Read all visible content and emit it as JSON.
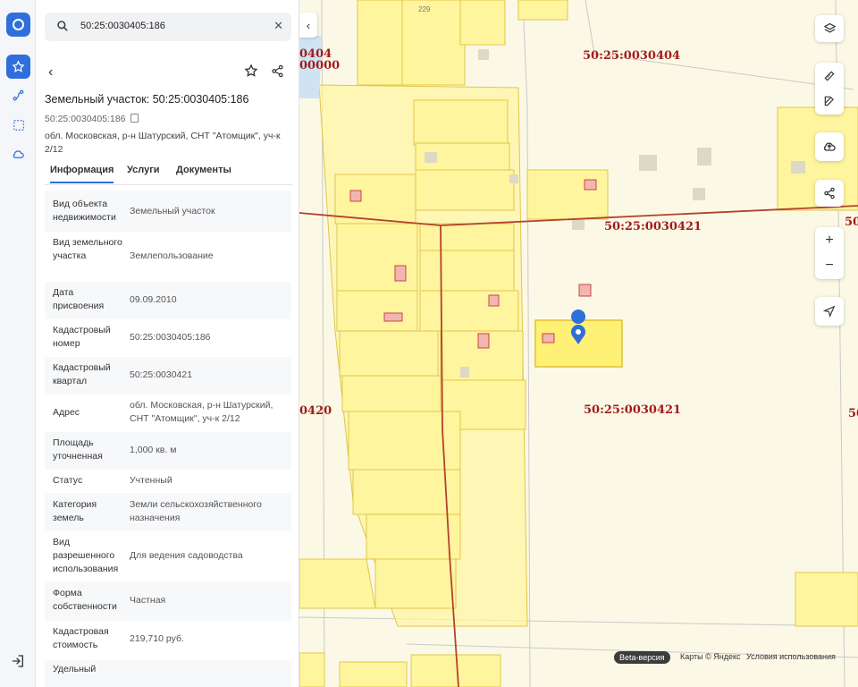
{
  "search": {
    "value": "50:25:0030405:186"
  },
  "header": {
    "title": "Земельный участок: 50:25:0030405:186",
    "cadastral_number": "50:25:0030405:186",
    "address": "обл. Московская, р-н Шатурский, СНТ \"Атомщик\", уч-к 2/12"
  },
  "tabs": [
    "Информация",
    "Услуги",
    "Документы"
  ],
  "properties": [
    {
      "key": "Вид объекта недвижимости",
      "value": "Земельный участок"
    },
    {
      "key": "Вид земельного участка",
      "value": "Землепользование"
    },
    {
      "key": "Дата присвоения",
      "value": "09.09.2010"
    },
    {
      "key": "Кадастровый номер",
      "value": "50:25:0030405:186"
    },
    {
      "key": "Кадастровый квартал",
      "value": "50:25:0030421"
    },
    {
      "key": "Адрес",
      "value": "обл. Московская, р-н Шатурский, СНТ \"Атомщик\", уч-к 2/12"
    },
    {
      "key": "Площадь уточненная",
      "value": "1,000 кв. м"
    },
    {
      "key": "Статус",
      "value": "Учтенный"
    },
    {
      "key": "Категория земель",
      "value": "Земли сельскохозяйственного назначения"
    },
    {
      "key": "Вид разрешенного использования",
      "value": "Для ведения садоводства"
    },
    {
      "key": "Форма собственности",
      "value": "Частная"
    },
    {
      "key": "Кадастровая стоимость",
      "value": "219,710 руб."
    },
    {
      "key": "Удельный",
      "value": ""
    }
  ],
  "map": {
    "labels": {
      "q0404": "50:25:0030404",
      "q0421a": "50:25:0030421",
      "q0421b": "50:25:0030421",
      "q0420": "0420",
      "left_top_a": "0404",
      "left_top_b": "00000",
      "num229": "229",
      "edge_right": "50",
      "edge_right2": "50"
    },
    "beta": "Beta-версия",
    "copyright": "Карты © Яндекс",
    "terms": "Условия использования"
  },
  "icons": {
    "rail": [
      "logo-icon",
      "favorites-star-icon",
      "route-icon",
      "select-area-icon",
      "cloud-icon",
      "logout-icon"
    ],
    "map_controls": [
      "layers-icon",
      "ruler-icon",
      "edit-icon",
      "upload-icon",
      "share-icon",
      "zoom-in-icon",
      "zoom-out-icon",
      "locate-icon"
    ]
  },
  "colors": {
    "accent": "#2f6fdb",
    "parcel_fill": "#fff59e",
    "parcel_border": "#e0c64a",
    "boundary": "#b5412f",
    "label": "#a31c1c"
  }
}
